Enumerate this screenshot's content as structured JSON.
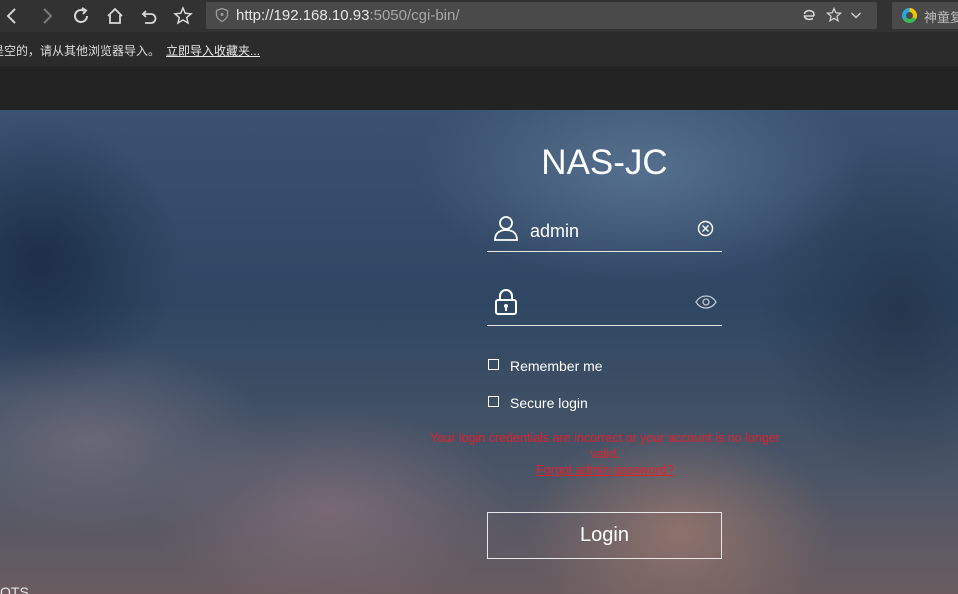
{
  "browser": {
    "url_host": "http://192.168.10.93",
    "url_rest": ":5050/cgi-bin/",
    "search_text": "神童复"
  },
  "notice": {
    "text": "是空的，请从其他浏览器导入。",
    "link": "立即导入收藏夹..."
  },
  "login": {
    "title": "NAS-JC",
    "username_value": "admin",
    "password_placeholder": "",
    "remember_label": "Remember me",
    "secure_label": "Secure login",
    "error_message": "Your login credentials are incorrect or your account is no longer valid.",
    "forgot_link": "Forgot admin password?",
    "login_button": "Login"
  },
  "page": {
    "bottom_fragment": "OTS"
  },
  "colors": {
    "error": "#e4202d",
    "toolbar": "#323232",
    "header": "#232323"
  }
}
